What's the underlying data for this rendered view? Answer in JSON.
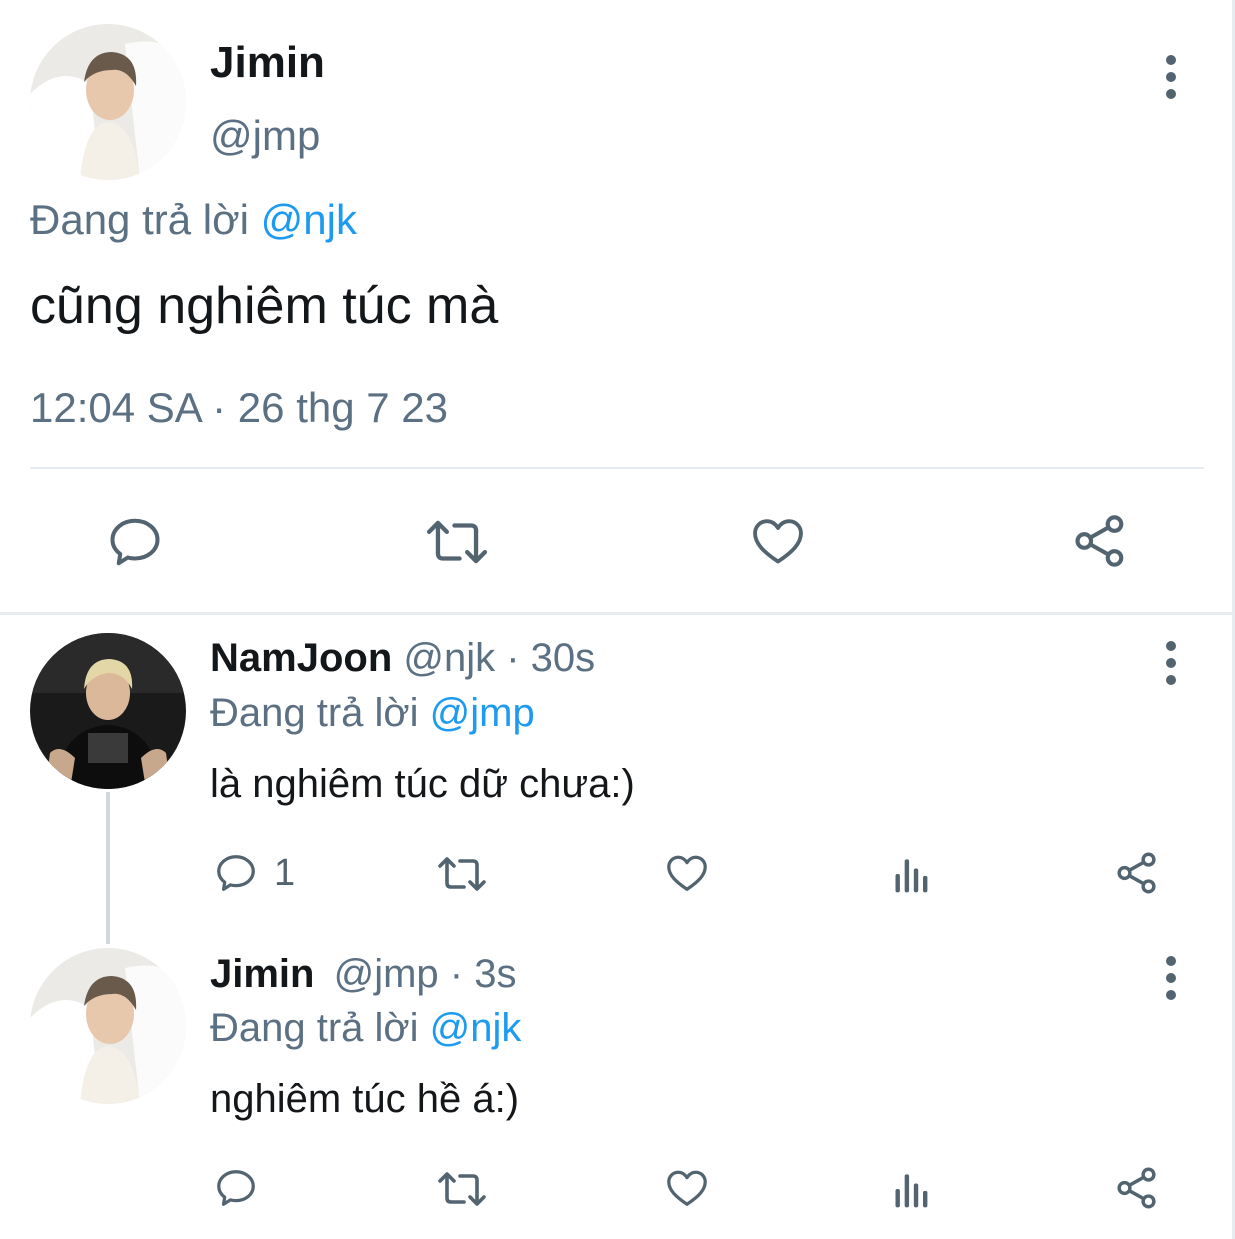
{
  "main_tweet": {
    "name": "Jimin",
    "handle": "@jmp",
    "reply_prefix": "Đang trả lời ",
    "reply_mention": "@njk",
    "text": "cũng nghiêm túc mà",
    "timestamp": "12:04 SA · 26 thg 7 23",
    "actions": [
      "reply-icon",
      "retweet-icon",
      "like-icon",
      "share-icon"
    ]
  },
  "replies": [
    {
      "name": "NamJoon",
      "handle": "@njk · 30s",
      "reply_prefix": "Đang trả lời ",
      "reply_mention": "@jmp",
      "text": "là nghiêm túc dữ chưa:)",
      "reply_count": "1",
      "actions": [
        "reply-icon",
        "retweet-icon",
        "like-icon",
        "analytics-icon",
        "share-icon"
      ]
    },
    {
      "name": "Jimin",
      "handle": "@jmp · 3s",
      "reply_prefix": "Đang trả lời ",
      "reply_mention": "@njk",
      "text": "nghiêm túc hề á:)",
      "reply_count": "",
      "actions": [
        "reply-icon",
        "retweet-icon",
        "like-icon",
        "analytics-icon",
        "share-icon"
      ]
    }
  ],
  "colors": {
    "accent": "#1d9bf0",
    "secondary_text": "#5b7083",
    "icon": "#536471",
    "divider": "#e6ecf0"
  }
}
